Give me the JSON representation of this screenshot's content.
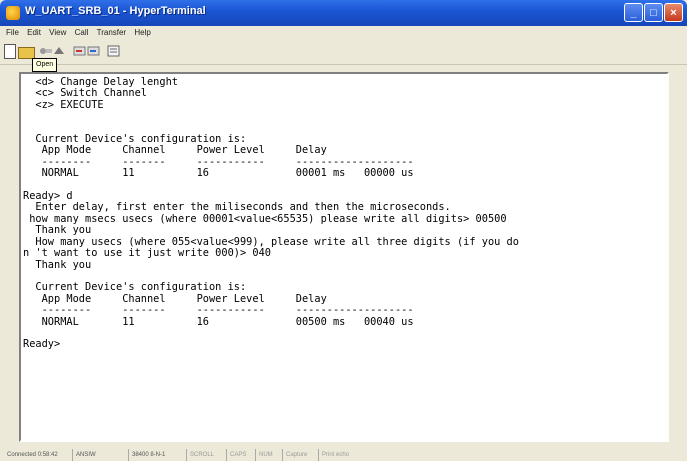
{
  "window": {
    "title": "W_UART_SRB_01 - HyperTerminal",
    "minimize": "_",
    "maximize": "□",
    "close": "×"
  },
  "menu": [
    "File",
    "Edit",
    "View",
    "Call",
    "Transfer",
    "Help"
  ],
  "toolbar": {
    "tooltip": "Open",
    "icons": [
      "new-icon",
      "open-icon",
      "disconnect-icon",
      "dial-icon",
      "send-icon",
      "receive-icon",
      "properties-icon"
    ]
  },
  "terminal": {
    "lines": [
      "  <d> Change Delay lenght",
      "  <c> Switch Channel",
      "  <z> EXECUTE",
      "",
      "",
      "  Current Device's configuration is:",
      "   App Mode     Channel     Power Level     Delay",
      "   --------     -------     -----------     -------------------",
      "   NORMAL       11          16              00001 ms   00000 us",
      "",
      "Ready> d",
      "  Enter delay, first enter the miliseconds and then the microseconds.",
      " how many msecs usecs (where 00001<value<65535) please write all digits> 00500",
      "  Thank you",
      "  How many usecs (where 055<value<999), please write all three digits (if you do",
      "n 't want to use it just write 000)> 040",
      "  Thank you",
      "",
      "  Current Device's configuration is:",
      "   App Mode     Channel     Power Level     Delay",
      "   --------     -------     -----------     -------------------",
      "   NORMAL       11          16              00500 ms   00040 us",
      "",
      "Ready>"
    ]
  },
  "status": {
    "connected": "Connected 0:58:42",
    "emulation": "ANSIW",
    "settings": "38400 8-N-1",
    "scroll": "SCROLL",
    "caps": "CAPS",
    "num": "NUM",
    "capture": "Capture",
    "print_echo": "Print echo"
  }
}
